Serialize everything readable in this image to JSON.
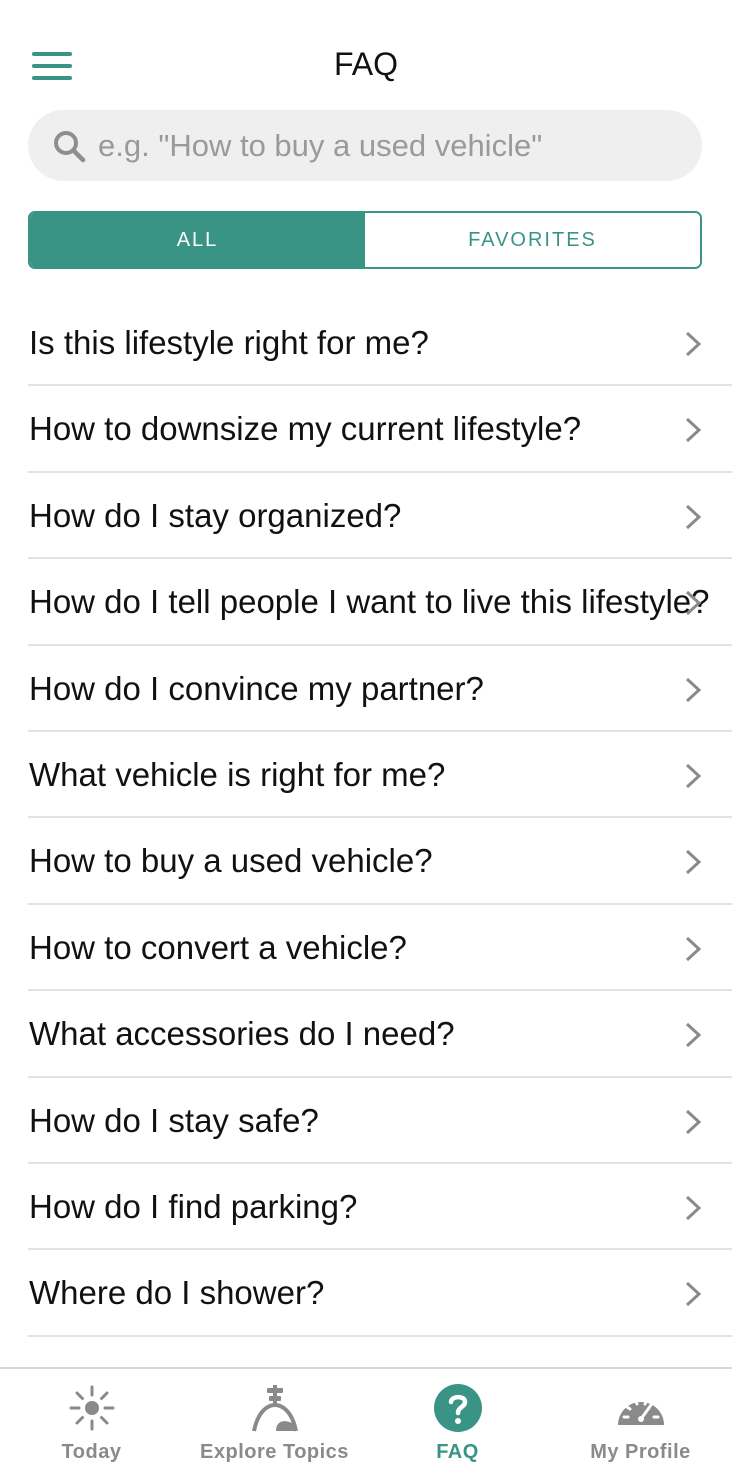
{
  "header": {
    "title": "FAQ",
    "menu_icon": "hamburger-menu-icon"
  },
  "search": {
    "placeholder": "e.g. \"How to buy a used vehicle\"",
    "value": "",
    "icon": "search-icon"
  },
  "segments": [
    {
      "label": "ALL",
      "active": true
    },
    {
      "label": "FAVORITES",
      "active": false
    }
  ],
  "faq": [
    {
      "label": "Is this lifestyle right for me?"
    },
    {
      "label": "How to downsize my current lifestyle?"
    },
    {
      "label": "How do I stay organized?"
    },
    {
      "label": "How do I tell people I want to live this lifestyle?"
    },
    {
      "label": "How do I convince my partner?"
    },
    {
      "label": "What vehicle is right for me?"
    },
    {
      "label": "How to buy a used vehicle?"
    },
    {
      "label": "How to convert a vehicle?"
    },
    {
      "label": "What accessories do I need?"
    },
    {
      "label": "How do I stay safe?"
    },
    {
      "label": "How do I find parking?"
    },
    {
      "label": "Where do I shower?"
    }
  ],
  "tabs": [
    {
      "label": "Today",
      "icon": "sun-icon",
      "active": false
    },
    {
      "label": "Explore Topics",
      "icon": "signpost-icon",
      "active": false
    },
    {
      "label": "FAQ",
      "icon": "question-circle-icon",
      "active": true
    },
    {
      "label": "My Profile",
      "icon": "speedometer-icon",
      "active": false
    }
  ],
  "colors": {
    "accent": "#3a9486",
    "search_bg": "#efefef",
    "divider": "#e2e2e2",
    "tab_inactive": "#8a8a8a"
  }
}
